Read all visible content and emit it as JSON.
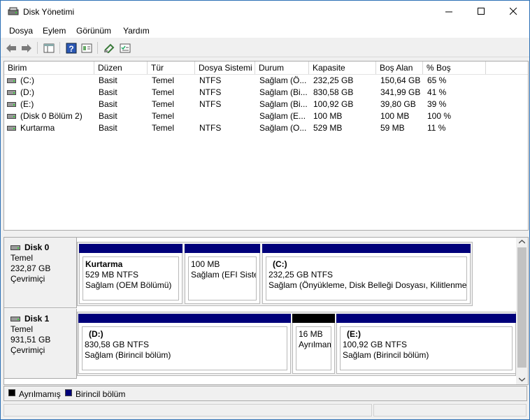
{
  "window": {
    "title": "Disk Yönetimi"
  },
  "menu": [
    "Dosya",
    "Eylem",
    "Görünüm",
    "Yardım"
  ],
  "volume_list": {
    "columns": [
      "Birim",
      "Düzen",
      "Tür",
      "Dosya Sistemi",
      "Durum",
      "Kapasite",
      "Boş Alan",
      "% Boş"
    ],
    "rows": [
      [
        "(C:)",
        "Basit",
        "Temel",
        "NTFS",
        "Sağlam (Ö...",
        "232,25 GB",
        "150,64 GB",
        "65 %"
      ],
      [
        "(D:)",
        "Basit",
        "Temel",
        "NTFS",
        "Sağlam (Bi...",
        "830,58 GB",
        "341,99 GB",
        "41 %"
      ],
      [
        "(E:)",
        "Basit",
        "Temel",
        "NTFS",
        "Sağlam (Bi...",
        "100,92 GB",
        "39,80 GB",
        "39 %"
      ],
      [
        "(Disk 0 Bölüm 2)",
        "Basit",
        "Temel",
        "",
        "Sağlam (E...",
        "100 MB",
        "100 MB",
        "100 %"
      ],
      [
        "Kurtarma",
        "Basit",
        "Temel",
        "NTFS",
        "Sağlam (O...",
        "529 MB",
        "59 MB",
        "11 %"
      ]
    ]
  },
  "disks": [
    {
      "name": "Disk 0",
      "type": "Temel",
      "size": "232,87 GB",
      "status": "Çevrimiçi",
      "partitions": [
        {
          "name": "Kurtarma",
          "info": "529 MB NTFS",
          "status": "Sağlam (OEM Bölümü)"
        },
        {
          "name": "",
          "info": "100 MB",
          "status": "Sağlam (EFI Sistem"
        },
        {
          "name": "(C:)",
          "info": "232,25 GB NTFS",
          "status": "Sağlam (Önyükleme, Disk Belleği Dosyası, Kilitlenme B"
        }
      ]
    },
    {
      "name": "Disk 1",
      "type": "Temel",
      "size": "931,51 GB",
      "status": "Çevrimiçi",
      "partitions": [
        {
          "name": "(D:)",
          "info": "830,58 GB NTFS",
          "status": "Sağlam (Birincil bölüm)"
        },
        {
          "name": "",
          "info": "16 MB",
          "status": "Ayrılmamış"
        },
        {
          "name": "(E:)",
          "info": "100,92 GB NTFS",
          "status": "Sağlam (Birincil bölüm)"
        }
      ]
    }
  ],
  "legend": {
    "unallocated": "Ayrılmamış",
    "primary": "Birincil bölüm"
  },
  "colors": {
    "primary": "#00007a",
    "unallocated": "#000000",
    "titlebar_border": "#2b6fb5"
  }
}
